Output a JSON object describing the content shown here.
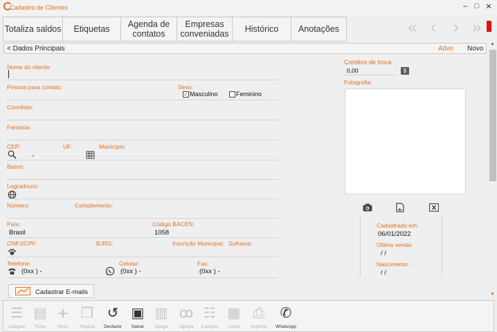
{
  "window": {
    "title": "Cadastro de Clientes",
    "minimize": "–",
    "maximize": "□",
    "close": "✕"
  },
  "tabs": [
    {
      "label": "Totaliza saldos"
    },
    {
      "label": "Etiquetas"
    },
    {
      "label": "Agenda de contatos"
    },
    {
      "label": "Empresas conveniadas"
    },
    {
      "label": "Histórico"
    },
    {
      "label": "Anotações"
    }
  ],
  "nav": {
    "first": "«",
    "prev": "‹",
    "next": "›",
    "last": "»"
  },
  "section": {
    "title": "< Dados Principais",
    "status": "Ativo",
    "mode": "Novo"
  },
  "form": {
    "nome_label": "Nome do cliente:",
    "contato_label": "Pessoa para contato:",
    "sexo_label": "Sexo:",
    "masculino_label": "Masculino",
    "feminino_label": "Feminino",
    "masculino_checked": true,
    "feminino_checked": false,
    "convenio_label": "Convênio:",
    "fantasia_label": "Fantasia:",
    "cep_label": "CEP:",
    "cep_value": "-",
    "uf_label": "UF:",
    "municipio_label": "Município:",
    "bairro_label": "Bairro:",
    "logradouro_label": "Logradouro:",
    "numero_label": "Número:",
    "complemento_label": "Complemento:",
    "pais_label": "País:",
    "pais_value": "Brasil",
    "bacen_label": "Código BACEN:",
    "bacen_value": "1058",
    "cnpj_label": "CNPJ/CPF:",
    "ie_label": "IE/RG:",
    "inscricao_label": "Inscrição Municipal:",
    "suframa_label": "Suframa:",
    "telefone_label": "Telefone:",
    "telefone_value": "(0xx )   -",
    "celular_label": "Celular:",
    "celular_value": "(0xx )   -",
    "fax_label": "Fax:",
    "fax_value": "(0xx )   -"
  },
  "right_panel": {
    "creditos_label": "Créditos de troca",
    "creditos_value": "0,00",
    "dollar_label": "$",
    "fotografia_label": "Fotografia:",
    "cadastrado_label": "Cadastrado em:",
    "cadastrado_value": "06/01/2022",
    "ultima_venda_label": "Última venda:",
    "ultima_venda_value": "/ /",
    "nascimento_label": "Nascimento:",
    "nascimento_value": "/ /"
  },
  "email_button": {
    "label": "Cadastrar E-mails"
  },
  "toolbar": [
    {
      "label": "Listagem",
      "icon": "list-icon",
      "glyph": "☰",
      "active": false
    },
    {
      "label": "Ficha",
      "icon": "document-icon",
      "glyph": "▤",
      "active": false
    },
    {
      "label": "Novo",
      "icon": "plus-icon",
      "glyph": "+",
      "active": false
    },
    {
      "label": "Replica",
      "icon": "copy-icon",
      "glyph": "❐",
      "active": false
    },
    {
      "label": "Desfazer",
      "icon": "undo-icon",
      "glyph": "↺",
      "active": true
    },
    {
      "label": "Salvar",
      "icon": "save-icon",
      "glyph": "▣",
      "active": true
    },
    {
      "label": "Apaga",
      "icon": "trash-icon",
      "glyph": "▥",
      "active": false
    },
    {
      "label": "Agrupa",
      "icon": "group-icon",
      "glyph": "ꝏ",
      "active": false
    },
    {
      "label": "Campos",
      "icon": "fields-icon",
      "glyph": "☷",
      "active": false
    },
    {
      "label": "Listas",
      "icon": "lists-icon",
      "glyph": "▦",
      "active": false
    },
    {
      "label": "Imprime",
      "icon": "printer-icon",
      "glyph": "⎙",
      "active": false
    },
    {
      "label": "WhatsApp",
      "icon": "whatsapp-icon",
      "glyph": "✆",
      "active": true
    }
  ],
  "colors": {
    "accent": "#e07020",
    "red_marker": "#e01010"
  }
}
